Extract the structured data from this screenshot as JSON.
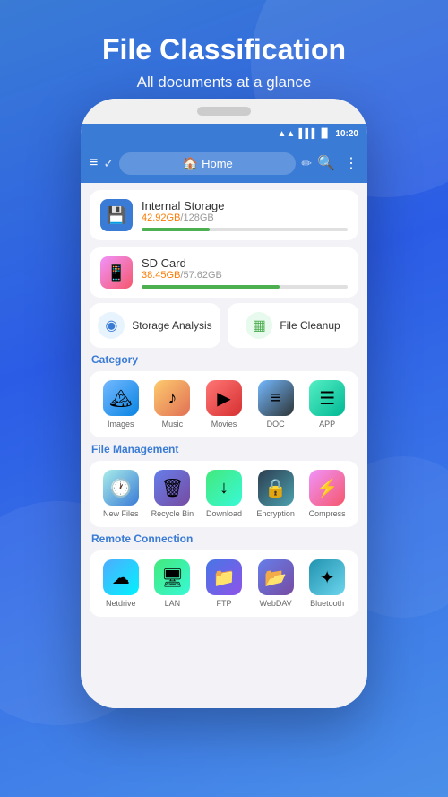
{
  "page": {
    "title": "File Classification",
    "subtitle": "All documents at a glance"
  },
  "status_bar": {
    "wifi": "📶",
    "signal": "📶",
    "battery": "🔋",
    "time": "10:20"
  },
  "app_bar": {
    "home_label": "Home"
  },
  "storage": [
    {
      "name": "Internal Storage",
      "size_used": "42.92GB",
      "size_total": "128GB",
      "progress": 33,
      "icon": "💾",
      "icon_type": "internal"
    },
    {
      "name": "SD Card",
      "size_used": "38.45GB",
      "size_total": "57.62GB",
      "progress": 67,
      "icon": "📱",
      "icon_type": "sd"
    }
  ],
  "quick_actions": [
    {
      "label": "Storage Analysis",
      "icon": "🔵",
      "type": "analysis"
    },
    {
      "label": "File Cleanup",
      "icon": "🟢",
      "type": "cleanup"
    }
  ],
  "category": {
    "title": "Category",
    "items": [
      {
        "label": "Images",
        "icon": "🏔️",
        "type": "images"
      },
      {
        "label": "Music",
        "icon": "🎵",
        "type": "music"
      },
      {
        "label": "Movies",
        "icon": "🎬",
        "type": "movies"
      },
      {
        "label": "DOC",
        "icon": "📄",
        "type": "doc"
      },
      {
        "label": "APP",
        "icon": "📦",
        "type": "app"
      }
    ]
  },
  "file_management": {
    "title": "File Management",
    "items": [
      {
        "label": "New Files",
        "icon": "🕐",
        "type": "newfiles"
      },
      {
        "label": "Recycle Bin",
        "icon": "🗑️",
        "type": "recycle"
      },
      {
        "label": "Download",
        "icon": "⬇️",
        "type": "download"
      },
      {
        "label": "Encryption",
        "icon": "🔐",
        "type": "encrypt"
      },
      {
        "label": "Compress",
        "icon": "📦",
        "type": "compress"
      }
    ]
  },
  "remote_connection": {
    "title": "Remote Connection",
    "items": [
      {
        "label": "Netdrive",
        "icon": "☁️",
        "type": "netdrive"
      },
      {
        "label": "LAN",
        "icon": "🖥️",
        "type": "lan"
      },
      {
        "label": "FTP",
        "icon": "📁",
        "type": "ftp"
      },
      {
        "label": "WebDAV",
        "icon": "🗂️",
        "type": "webdav"
      },
      {
        "label": "Bluetooth",
        "icon": "📶",
        "type": "bt"
      }
    ]
  }
}
